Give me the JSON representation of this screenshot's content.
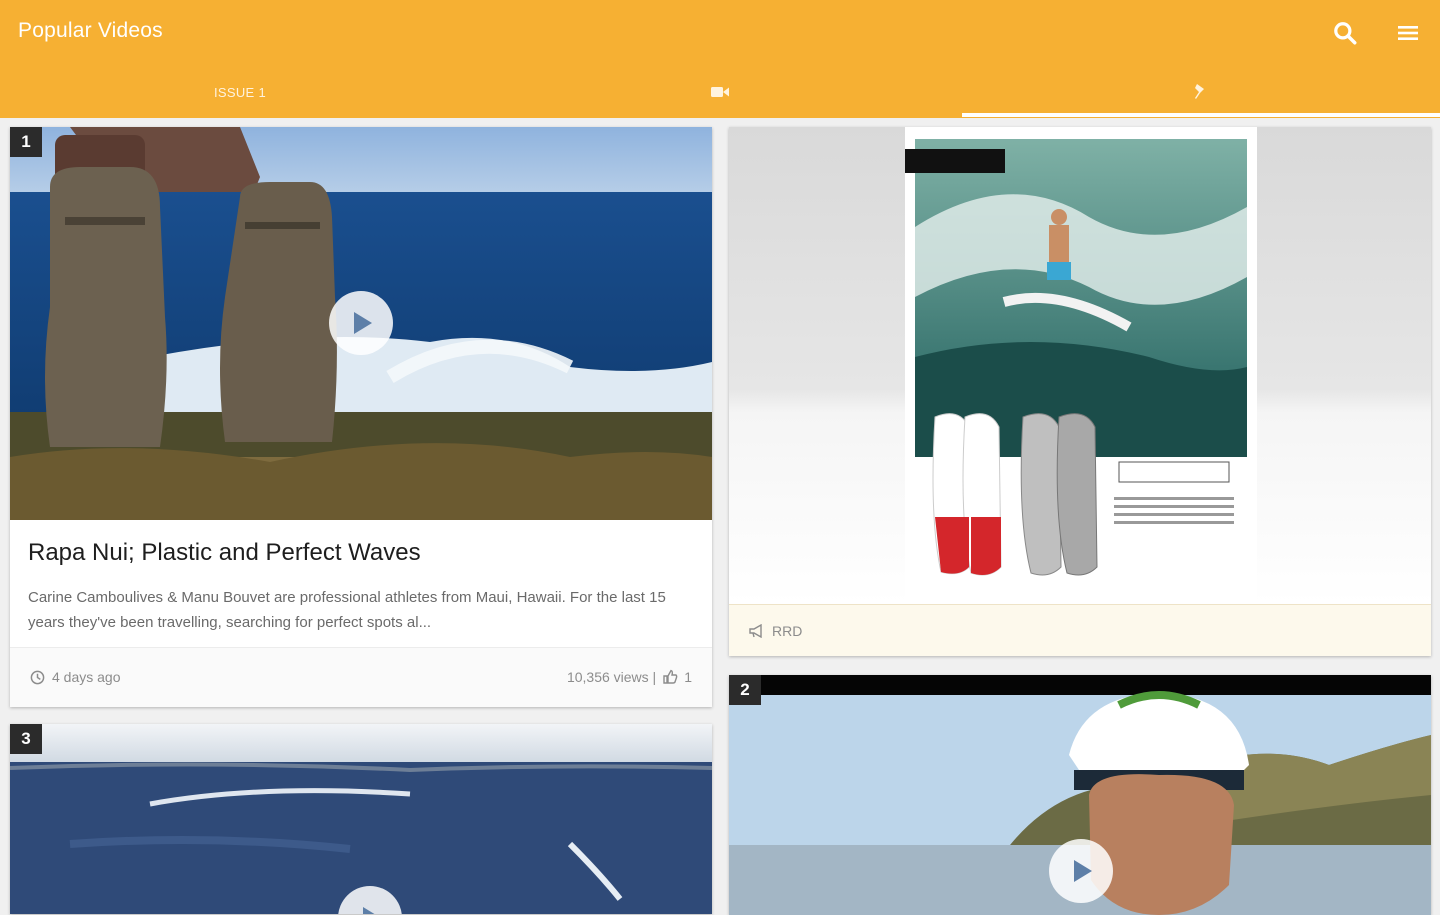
{
  "header": {
    "title": "Popular Videos",
    "search_icon": "search-icon",
    "menu_icon": "menu-icon",
    "tabs": [
      {
        "label": "ISSUE 1",
        "icon": ""
      },
      {
        "label": "",
        "icon": "video-camera-icon"
      },
      {
        "label": "",
        "icon": "pin-icon"
      }
    ],
    "active_tab": 2,
    "color": "#f6b033"
  },
  "feed": {
    "cards": [
      {
        "rank": "1",
        "title": "Rapa Nui; Plastic and Perfect Waves",
        "description": "Carine Camboulives & Manu Bouvet are professional athletes from Maui, Hawaii. For the last 15 years they've been travelling, searching for perfect spots al...",
        "time": "4 days ago",
        "views": "10,356 views |",
        "likes": "1"
      },
      {
        "rank": "3"
      },
      {
        "rank": "2"
      }
    ],
    "ad": {
      "sponsor": "RRD"
    }
  }
}
